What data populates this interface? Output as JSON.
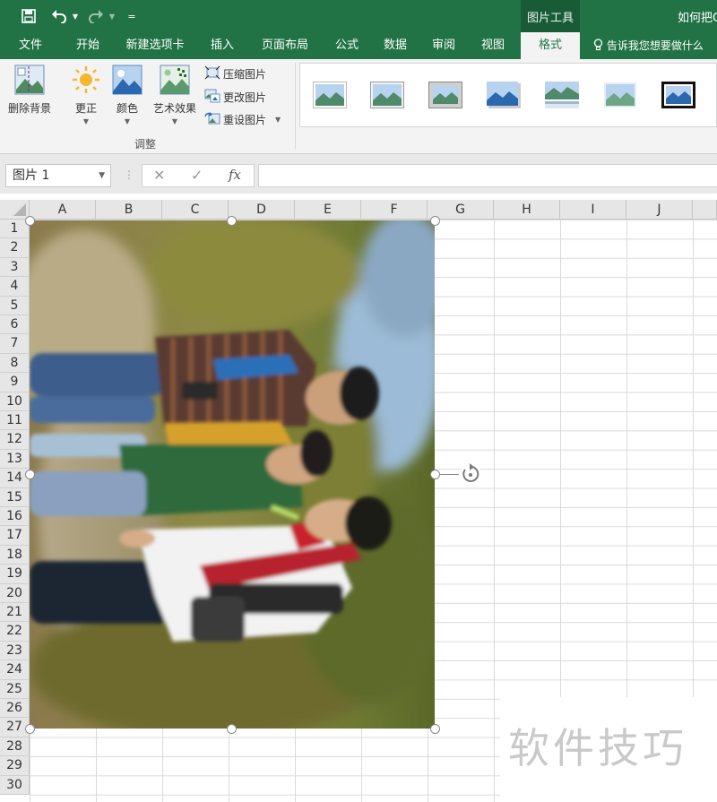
{
  "title_bar": {
    "picture_tools_label": "图片工具",
    "document_title": "如何把C",
    "customize_label": "="
  },
  "tabs": [
    "文件",
    "开始",
    "新建选项卡",
    "插入",
    "页面布局",
    "公式",
    "数据",
    "审阅",
    "视图",
    "格式"
  ],
  "active_tab": "格式",
  "tell_me": "告诉我您想要做什么",
  "ribbon": {
    "remove_background": "删除背景",
    "corrections": "更正",
    "color": "颜色",
    "artistic_effects": "艺术效果",
    "compress_pictures": "压缩图片",
    "change_picture": "更改图片",
    "reset_picture": "重设图片",
    "group_adjust": "调整"
  },
  "formula_bar": {
    "name_box": "图片 1",
    "fx": "fx",
    "value": ""
  },
  "columns": [
    "A",
    "B",
    "C",
    "D",
    "E",
    "F",
    "G",
    "H",
    "I",
    "J"
  ],
  "rows": [
    "1",
    "2",
    "3",
    "4",
    "5",
    "6",
    "7",
    "8",
    "9",
    "10",
    "11",
    "12",
    "13",
    "14",
    "15",
    "16",
    "17",
    "18",
    "19",
    "20",
    "21",
    "22",
    "23",
    "24",
    "25",
    "26",
    "27",
    "28",
    "29",
    "30"
  ],
  "watermark": "软件技巧",
  "colors": {
    "excel_green": "#217346",
    "ribbon_bg": "#f3f3f3",
    "grid_line": "#dadada"
  }
}
